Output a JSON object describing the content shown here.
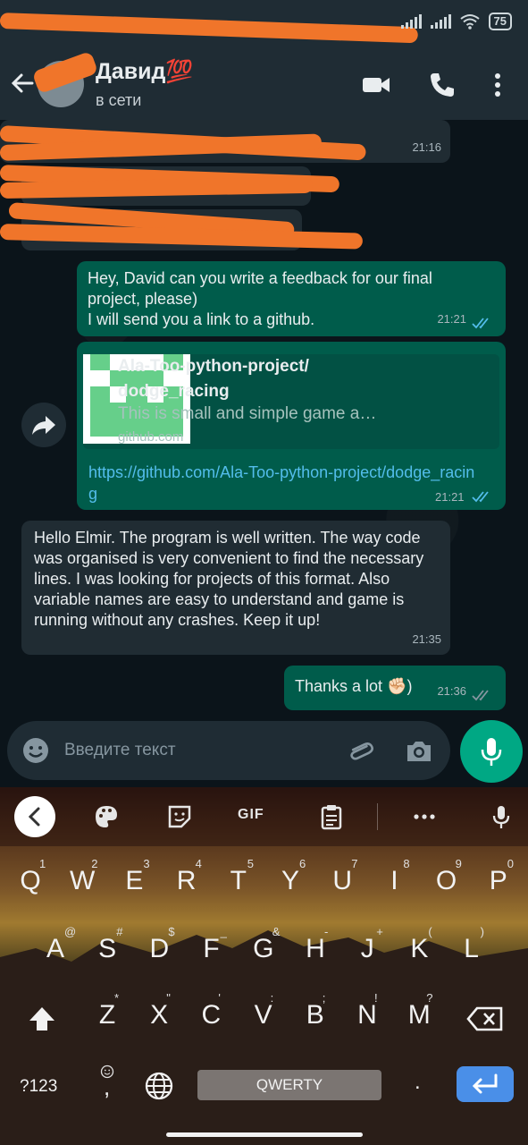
{
  "status_bar": {
    "battery": "75"
  },
  "header": {
    "contact_name": "Давид💯",
    "contact_status": "в сети"
  },
  "messages": [
    {
      "id": "m1",
      "direction": "in",
      "time": "21:16"
    },
    {
      "id": "m2",
      "direction": "in",
      "time": "21:16"
    },
    {
      "id": "m3",
      "direction": "out",
      "text": "Hey, David can you write a feedback for our final project, please)\nI will send you a link to a github.",
      "time": "21:21"
    },
    {
      "id": "m4",
      "direction": "out",
      "link_title": "Ala-Too-python-project/ dodge_racing",
      "link_description": "This is small and simple game a…",
      "link_domain": "github.com",
      "url": "https://github.com/Ala-Too-python-project/dodge_racing",
      "time": "21:21"
    },
    {
      "id": "m5",
      "direction": "in",
      "text": "Hello Elmir. The program is well written. The way code was organised is very convenient to find the necessary lines. I was looking for projects of this format. Also variable names are easy to understand and game is running without any crashes. Keep it up!",
      "time": "21:35"
    },
    {
      "id": "m6",
      "direction": "out",
      "text": "Thanks a lot ✊🏻)",
      "time": "21:36"
    }
  ],
  "input": {
    "placeholder": "Введите текст"
  },
  "keyboard": {
    "toolbar": {
      "gif_label": "GIF"
    },
    "row1": [
      {
        "key": "Q",
        "hint": "1"
      },
      {
        "key": "W",
        "hint": "2"
      },
      {
        "key": "E",
        "hint": "3"
      },
      {
        "key": "R",
        "hint": "4"
      },
      {
        "key": "T",
        "hint": "5"
      },
      {
        "key": "Y",
        "hint": "6"
      },
      {
        "key": "U",
        "hint": "7"
      },
      {
        "key": "I",
        "hint": "8"
      },
      {
        "key": "O",
        "hint": "9"
      },
      {
        "key": "P",
        "hint": "0"
      }
    ],
    "row2": [
      {
        "key": "A",
        "hint": "@"
      },
      {
        "key": "S",
        "hint": "#"
      },
      {
        "key": "D",
        "hint": "$"
      },
      {
        "key": "F",
        "hint": "_"
      },
      {
        "key": "G",
        "hint": "&"
      },
      {
        "key": "H",
        "hint": "-"
      },
      {
        "key": "J",
        "hint": "+"
      },
      {
        "key": "K",
        "hint": "("
      },
      {
        "key": "L",
        "hint": ")"
      }
    ],
    "row3": [
      {
        "key": "Z",
        "hint": "*"
      },
      {
        "key": "X",
        "hint": "\""
      },
      {
        "key": "C",
        "hint": "'"
      },
      {
        "key": "V",
        "hint": ":"
      },
      {
        "key": "B",
        "hint": ";"
      },
      {
        "key": "N",
        "hint": "!"
      },
      {
        "key": "M",
        "hint": "?"
      }
    ],
    "sym_label": "?123",
    "comma": ",",
    "period": ".",
    "space_label": "QWERTY"
  },
  "colors": {
    "outgoing_bubble": "#005c4b",
    "incoming_bubble": "#202c33",
    "accent": "#00a884",
    "link": "#53bdeb",
    "read_ticks": "#53bdeb"
  },
  "icons": [
    "back-arrow-icon",
    "video-call-icon",
    "phone-icon",
    "more-vert-icon",
    "forward-icon",
    "emoji-icon",
    "attach-icon",
    "camera-icon",
    "mic-icon",
    "chevron-left-icon",
    "palette-icon",
    "sticker-icon",
    "clipboard-icon",
    "more-horiz-icon",
    "shift-icon",
    "backspace-icon",
    "globe-icon",
    "enter-icon"
  ]
}
